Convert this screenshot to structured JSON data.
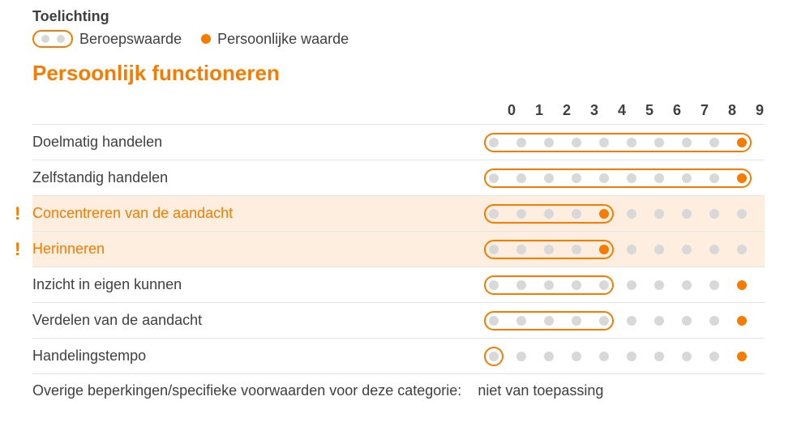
{
  "colors": {
    "accent": "#F57C00"
  },
  "legend": {
    "title": "Toelichting",
    "professional": "Beroepswaarde",
    "personal": "Persoonlijke waarde"
  },
  "section_title": "Persoonlijk functioneren",
  "scale_labels": [
    "0",
    "1",
    "2",
    "3",
    "4",
    "5",
    "6",
    "7",
    "8",
    "9"
  ],
  "chart_data": {
    "type": "table",
    "title": "Persoonlijk functioneren",
    "xlabel": "",
    "ylabel": "",
    "categories": [
      "0",
      "1",
      "2",
      "3",
      "4",
      "5",
      "6",
      "7",
      "8",
      "9"
    ],
    "series": [
      {
        "name": "Doelmatig handelen",
        "professional_range": [
          0,
          9
        ],
        "personal": 9,
        "alert": false
      },
      {
        "name": "Zelfstandig handelen",
        "professional_range": [
          0,
          9
        ],
        "personal": 9,
        "alert": false
      },
      {
        "name": "Concentreren van de aandacht",
        "professional_range": [
          0,
          4
        ],
        "personal": 4,
        "alert": true
      },
      {
        "name": "Herinneren",
        "professional_range": [
          0,
          4
        ],
        "personal": 4,
        "alert": true
      },
      {
        "name": "Inzicht in eigen kunnen",
        "professional_range": [
          0,
          4
        ],
        "personal": 9,
        "alert": false
      },
      {
        "name": "Verdelen van de aandacht",
        "professional_range": [
          0,
          4
        ],
        "personal": 9,
        "alert": false
      },
      {
        "name": "Handelingstempo",
        "professional_range": [
          0,
          0
        ],
        "personal": 9,
        "alert": false
      }
    ]
  },
  "footer": {
    "label": "Overige beperkingen/specifieke voorwaarden voor deze categorie:",
    "value": "niet van toepassing"
  }
}
